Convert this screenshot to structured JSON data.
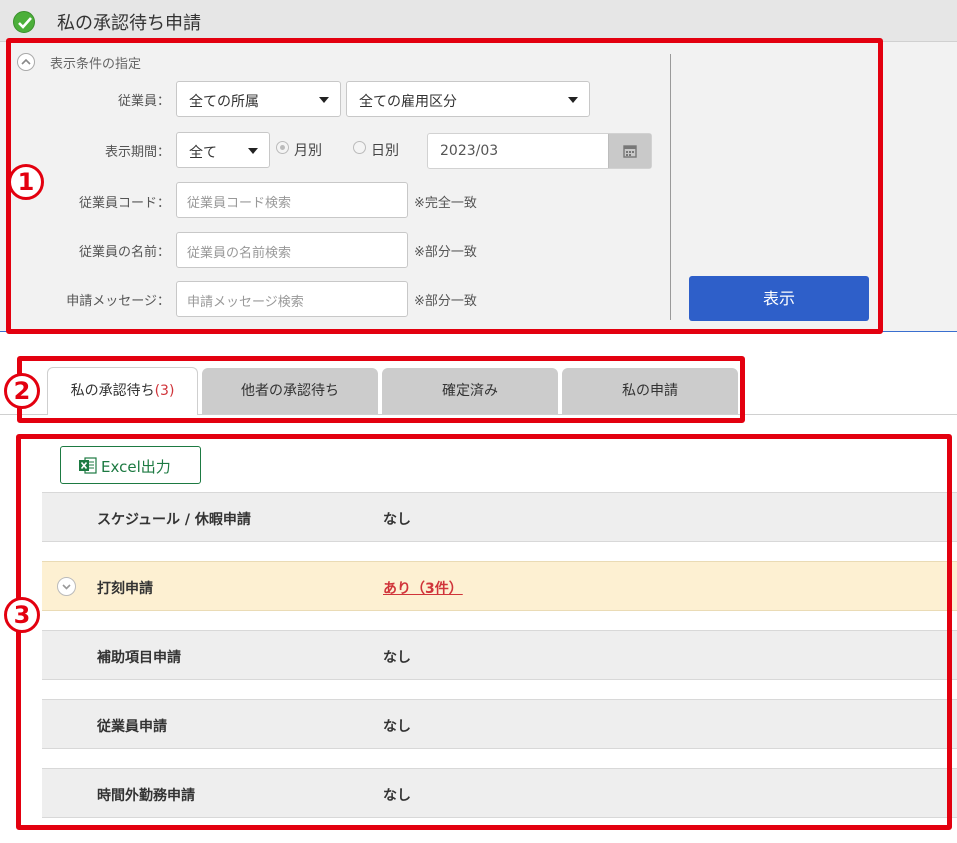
{
  "header": {
    "title": "私の承認待ち申請"
  },
  "filter": {
    "section_title": "表示条件の指定",
    "employee_label": "従業員：",
    "dept_select": "全ての所属",
    "employment_select": "全ての雇用区分",
    "period_label": "表示期間：",
    "period_select": "全て",
    "radio_monthly": "月別",
    "radio_daily": "日別",
    "date_value": "2023/03",
    "code_label": "従業員コード：",
    "code_placeholder": "従業員コード検索",
    "code_note": "※完全一致",
    "name_label": "従業員の名前：",
    "name_placeholder": "従業員の名前検索",
    "name_note": "※部分一致",
    "message_label": "申請メッセージ：",
    "message_placeholder": "申請メッセージ検索",
    "message_note": "※部分一致",
    "show_button": "表示"
  },
  "badges": {
    "b1": "1",
    "b2": "2",
    "b3": "3"
  },
  "tabs": [
    {
      "label": "私の承認待ち",
      "count": "(3)"
    },
    {
      "label": "他者の承認待ち"
    },
    {
      "label": "確定済み"
    },
    {
      "label": "私の申請"
    }
  ],
  "content": {
    "excel_button": "Excel出力",
    "rows": [
      {
        "name": "スケジュール / 休暇申請",
        "status": "なし"
      },
      {
        "name": "打刻申請",
        "status": "あり（3件）"
      },
      {
        "name": "補助項目申請",
        "status": "なし"
      },
      {
        "name": "従業員申請",
        "status": "なし"
      },
      {
        "name": "時間外勤務申請",
        "status": "なし"
      }
    ]
  },
  "colors": {
    "accent_blue": "#2e5fc9",
    "annotation_red": "#e3000f",
    "excel_green": "#1d7a42",
    "highlight_row": "#fdf0d2",
    "link_red": "#d0343a"
  }
}
